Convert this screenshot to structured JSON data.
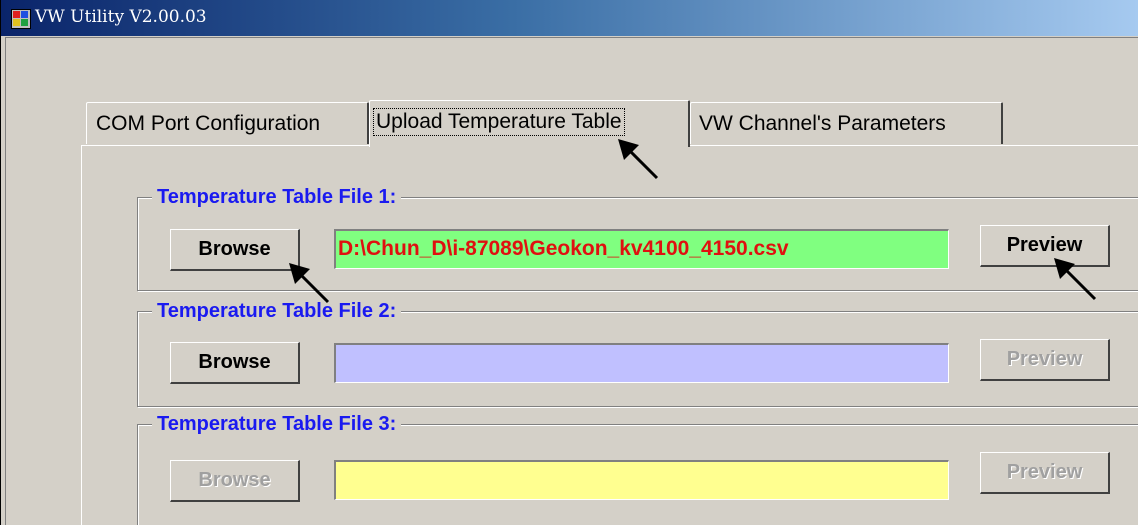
{
  "window": {
    "title": "VW Utility V2.00.03"
  },
  "tabs": [
    {
      "label": "COM Port Configuration"
    },
    {
      "label": "Upload Temperature Table"
    },
    {
      "label": "VW Channel's Parameters"
    }
  ],
  "groups": [
    {
      "title": "Temperature Table File 1:",
      "browse": "Browse",
      "path": "D:\\Chun_D\\i-87089\\Geokon_kv4100_4150.csv",
      "preview": "Preview",
      "field_color": "#80ff80",
      "browse_enabled": true,
      "preview_enabled": true
    },
    {
      "title": "Temperature Table File 2:",
      "browse": "Browse",
      "path": "",
      "preview": "Preview",
      "field_color": "#c0c0ff",
      "browse_enabled": true,
      "preview_enabled": false
    },
    {
      "title": "Temperature Table File 3:",
      "browse": "Browse",
      "path": "",
      "preview": "Preview",
      "field_color": "#ffff90",
      "browse_enabled": false,
      "preview_enabled": false
    }
  ],
  "colors": {
    "group_title": "#1a1af0",
    "path_text": "#e01010"
  }
}
